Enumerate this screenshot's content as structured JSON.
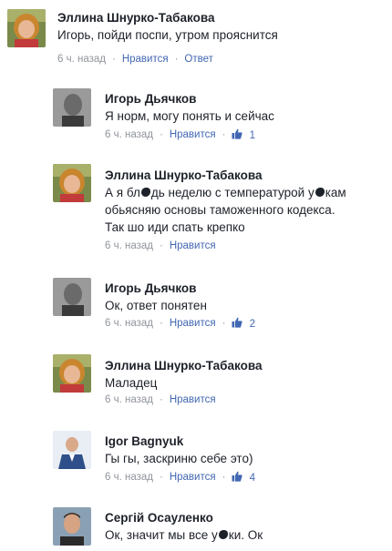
{
  "comments": [
    {
      "author": "Эллина Шнурко-Табакова",
      "text": [
        "Игорь, пойди поспи, утром прояснится"
      ],
      "time": "6 ч. назад",
      "like_label": "Нравится",
      "reply_label": "Ответ",
      "likes": ""
    },
    {
      "author": "Игорь Дьячков",
      "text": [
        "Я норм, могу понять и сейчас"
      ],
      "time": "6 ч. назад",
      "like_label": "Нравится",
      "likes": "1"
    },
    {
      "author": "Эллина Шнурко-Табакова",
      "text_line1_a": "А я бл",
      "text_line1_b": "дь неделю с температурой у",
      "text_line1_c": "кам",
      "text": [
        "обьясняю основы таможенного кодекса.",
        "Так шо иди спать крепко"
      ],
      "time": "6 ч. назад",
      "like_label": "Нравится",
      "likes": ""
    },
    {
      "author": "Игорь Дьячков",
      "text": [
        "Ок, ответ понятен"
      ],
      "time": "6 ч. назад",
      "like_label": "Нравится",
      "likes": "2"
    },
    {
      "author": "Эллина Шнурко-Табакова",
      "text": [
        "Маладец"
      ],
      "time": "6 ч. назад",
      "like_label": "Нравится",
      "likes": ""
    },
    {
      "author": "Igor Bagnyuk",
      "text": [
        "Гы гы, заскриню себе это)"
      ],
      "time": "6 ч. назад",
      "like_label": "Нравится",
      "likes": "4"
    },
    {
      "author": "Сергій Осауленко",
      "text_a": "Ок, значит мы все у",
      "text_b": "ки. Ок"
    }
  ],
  "icons": {
    "like": "thumbs-up-icon"
  },
  "colors": {
    "link": "#4267b2",
    "meta": "#90949c",
    "text": "#1d2129"
  }
}
